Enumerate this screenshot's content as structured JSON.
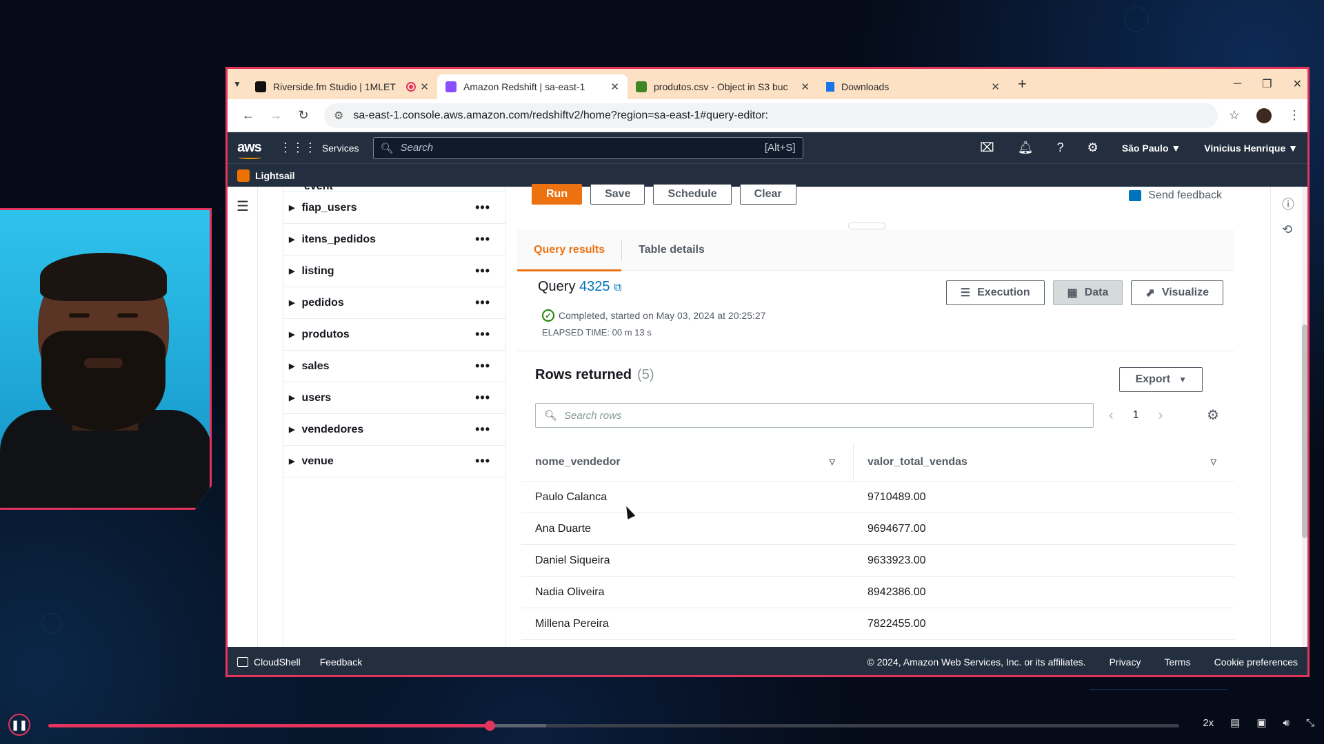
{
  "browser": {
    "tabs": [
      {
        "title": "Riverside.fm Studio | 1MLET",
        "active": false,
        "favicon_color": "#111111"
      },
      {
        "title": "Amazon Redshift | sa-east-1",
        "active": true,
        "favicon_color": "#8c4fff"
      },
      {
        "title": "produtos.csv - Object in S3 buc",
        "active": false,
        "favicon_color": "#3f8624"
      },
      {
        "title": "Downloads",
        "active": false,
        "favicon_color": "#1a73e8"
      }
    ],
    "url": "sa-east-1.console.aws.amazon.com/redshiftv2/home?region=sa-east-1#query-editor:"
  },
  "aws_nav": {
    "logo": "aws",
    "services_label": "Services",
    "search_placeholder": "Search",
    "search_shortcut": "[Alt+S]",
    "region": "São Paulo",
    "user": "Vinicius Henrique",
    "favorite": "Lightsail"
  },
  "tree": {
    "partial_item": "event",
    "items": [
      "fiap_users",
      "itens_pedidos",
      "listing",
      "pedidos",
      "produtos",
      "sales",
      "users",
      "vendedores",
      "venue"
    ]
  },
  "toolbar": {
    "run": "Run",
    "save": "Save",
    "schedule": "Schedule",
    "clear": "Clear",
    "feedback": "Send feedback"
  },
  "result_tabs": {
    "query_results": "Query results",
    "table_details": "Table details"
  },
  "query": {
    "label": "Query",
    "id": "4325",
    "status": "Completed, started on May 03, 2024 at 20:25:27",
    "elapsed": "ELAPSED TIME: 00 m 13 s",
    "buttons": {
      "execution": "Execution",
      "data": "Data",
      "visualize": "Visualize"
    }
  },
  "results": {
    "title": "Rows returned",
    "count": "(5)",
    "export": "Export",
    "search_placeholder": "Search rows",
    "page": "1",
    "columns": [
      "nome_vendedor",
      "valor_total_vendas"
    ],
    "rows": [
      [
        "Paulo Calanca",
        "9710489.00"
      ],
      [
        "Ana Duarte",
        "9694677.00"
      ],
      [
        "Daniel Siqueira",
        "9633923.00"
      ],
      [
        "Nadia Oliveira",
        "8942386.00"
      ],
      [
        "Millena Pereira",
        "7822455.00"
      ]
    ]
  },
  "footer": {
    "cloudshell": "CloudShell",
    "feedback": "Feedback",
    "copyright": "© 2024, Amazon Web Services, Inc. or its affiliates.",
    "privacy": "Privacy",
    "terms": "Terms",
    "cookies": "Cookie preferences"
  },
  "video": {
    "speed": "2x",
    "progress": 0.39
  },
  "colors": {
    "accent": "#ec7211",
    "frame": "#e2345d",
    "aws_nav": "#232f3e",
    "link": "#0073bb"
  }
}
